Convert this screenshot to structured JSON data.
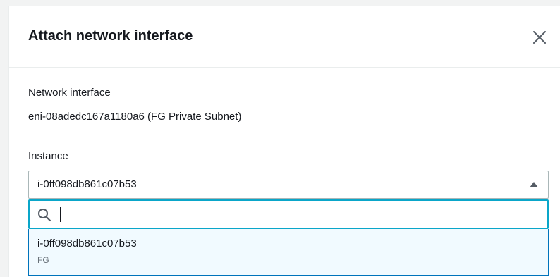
{
  "modal": {
    "title": "Attach network interface",
    "close_icon": "close-icon"
  },
  "network_interface": {
    "label": "Network interface",
    "value": "eni-08adedc167a1180a6 (FG Private Subnet)"
  },
  "instance": {
    "label": "Instance",
    "selected_value": "i-0ff098db861c07b53",
    "expanded": true,
    "search": {
      "value": "",
      "icon": "search-icon"
    },
    "options": [
      {
        "title": "i-0ff098db861c07b53",
        "subtitle": "FG"
      }
    ]
  },
  "colors": {
    "focus_ring": "#0aa6c9",
    "highlight_bg": "#f1faff",
    "highlight_border": "#0073bb"
  }
}
